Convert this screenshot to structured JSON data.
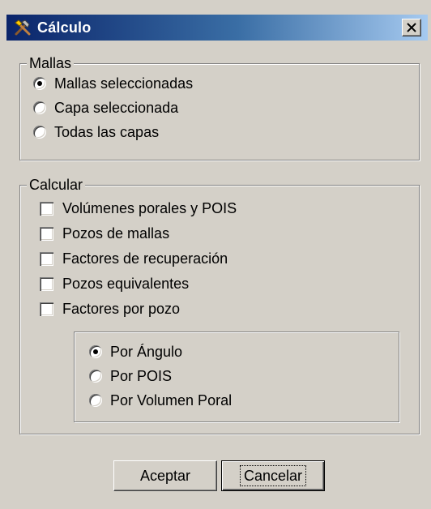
{
  "window": {
    "title": "Cálculo",
    "icon": "tools-icon",
    "close_label": "close"
  },
  "mallas": {
    "label": "Mallas",
    "options": [
      {
        "label": "Mallas seleccionadas",
        "checked": true
      },
      {
        "label": "Capa seleccionada",
        "checked": false
      },
      {
        "label": "Todas las capas",
        "checked": false
      }
    ]
  },
  "calcular": {
    "label": "Calcular",
    "items": [
      {
        "label": "Volúmenes porales y POIS",
        "checked": false
      },
      {
        "label": "Pozos de mallas",
        "checked": false
      },
      {
        "label": "Factores de recuperación",
        "checked": false
      },
      {
        "label": "Pozos equivalentes",
        "checked": false
      },
      {
        "label": "Factores por pozo",
        "checked": false
      }
    ],
    "sub_options": [
      {
        "label": "Por Ángulo",
        "checked": true
      },
      {
        "label": "Por POIS",
        "checked": false
      },
      {
        "label": "Por Volumen Poral",
        "checked": false
      }
    ]
  },
  "buttons": {
    "accept": "Aceptar",
    "cancel": "Cancelar"
  },
  "colors": {
    "face": "#d4d0c8",
    "title_start": "#0a246a",
    "title_end": "#a6caf0"
  }
}
